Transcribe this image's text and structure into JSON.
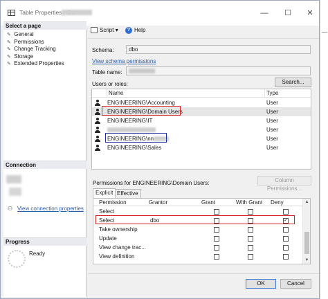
{
  "window": {
    "title": "Table Properties - Sal",
    "controls": {
      "minimize": "—",
      "maximize": "☐",
      "close": "✕"
    }
  },
  "left_pane": {
    "select_page_header": "Select a page",
    "pages": [
      "General",
      "Permissions",
      "Change Tracking",
      "Storage",
      "Extended Properties"
    ],
    "connection_header": "Connection",
    "view_connection_properties": "View connection properties",
    "progress_header": "Progress",
    "progress_status": "Ready"
  },
  "toolbar": {
    "script_label": "Script",
    "dropdown_arrow": "▾",
    "help_label": "Help"
  },
  "form": {
    "schema_label": "Schema:",
    "schema_value": "dbo",
    "view_schema_permissions": "View schema permissions",
    "table_name_label": "Table name:",
    "users_or_roles_label": "Users or roles:",
    "search_button": "Search..."
  },
  "users_table": {
    "columns": [
      "Name",
      "Type"
    ],
    "rows": [
      {
        "name": "ENGINEERING\\Accounting",
        "type": "User",
        "selected": false
      },
      {
        "name": "ENGINEERING\\Domain Users",
        "type": "User",
        "selected": true
      },
      {
        "name": "ENGINEERING\\IT",
        "type": "User",
        "selected": false
      },
      {
        "name": "",
        "type": "User",
        "selected": false
      },
      {
        "name": "ENGINEERING\\nn",
        "type": "User",
        "selected": false
      },
      {
        "name": "ENGINEERING\\Sales",
        "type": "User",
        "selected": false
      }
    ]
  },
  "permissions": {
    "label": "Permissions for ENGINEERING\\Domain Users:",
    "column_permissions_button": "Column Permissions...",
    "tabs": [
      "Explicit",
      "Effective"
    ],
    "columns": [
      "Permission",
      "Grantor",
      "Grant",
      "With Grant",
      "Deny"
    ],
    "rows": [
      {
        "permission": "Select",
        "grantor": "",
        "grant": false,
        "with_grant": false,
        "deny": false
      },
      {
        "permission": "Select",
        "grantor": "dbo",
        "grant": false,
        "with_grant": false,
        "deny": true
      },
      {
        "permission": "Take ownership",
        "grantor": "",
        "grant": false,
        "with_grant": false,
        "deny": false
      },
      {
        "permission": "Update",
        "grantor": "",
        "grant": false,
        "with_grant": false,
        "deny": false
      },
      {
        "permission": "View change trac...",
        "grantor": "",
        "grant": false,
        "with_grant": false,
        "deny": false
      },
      {
        "permission": "View definition",
        "grantor": "",
        "grant": false,
        "with_grant": false,
        "deny": false
      }
    ],
    "check_glyph": "✓"
  },
  "buttons": {
    "ok": "OK",
    "cancel": "Cancel"
  },
  "colors": {
    "highlight_red": "#d42020",
    "highlight_blue": "#1f2fa0",
    "link": "#2a5caa"
  }
}
